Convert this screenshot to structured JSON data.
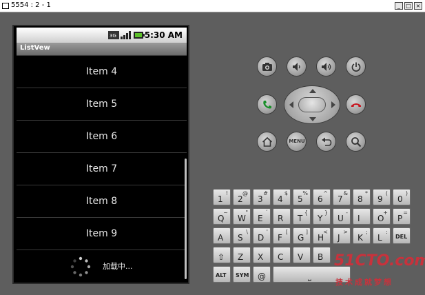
{
  "window": {
    "title": "5554 : 2 - 1",
    "minimize": "_",
    "maximize": "□",
    "close": "×"
  },
  "status_bar": {
    "time": "5:30 AM"
  },
  "app": {
    "title": "ListVew"
  },
  "list": {
    "items": [
      "Item 4",
      "Item 5",
      "Item 6",
      "Item 7",
      "Item 8",
      "Item 9"
    ],
    "loading_text": "加载中..."
  },
  "controls": {
    "camera": "camera-icon",
    "volume_down": "volume-down-icon",
    "volume_up": "volume-up-icon",
    "power": "power-icon",
    "call": "call-icon",
    "end_call": "end-call-icon",
    "home": "home-icon",
    "menu_label": "MENU",
    "back": "back-icon",
    "search": "search-icon"
  },
  "keyboard": {
    "row1": [
      [
        "1",
        "!"
      ],
      [
        "2",
        "@"
      ],
      [
        "3",
        "#"
      ],
      [
        "4",
        "$"
      ],
      [
        "5",
        "%"
      ],
      [
        "6",
        "^"
      ],
      [
        "7",
        "&"
      ],
      [
        "8",
        "*"
      ],
      [
        "9",
        "("
      ],
      [
        "0",
        ")"
      ]
    ],
    "row2": [
      [
        "Q",
        "~"
      ],
      [
        "W",
        "\""
      ],
      [
        "E",
        "´"
      ],
      [
        "R",
        ""
      ],
      [
        "T",
        "{"
      ],
      [
        "Y",
        "}"
      ],
      [
        "U",
        "-"
      ],
      [
        "I",
        ""
      ],
      [
        "O",
        "+"
      ],
      [
        "P",
        "="
      ]
    ],
    "row3": [
      [
        "A",
        ""
      ],
      [
        "S",
        "\\"
      ],
      [
        "D",
        "'"
      ],
      [
        "F",
        "["
      ],
      [
        "G",
        "]"
      ],
      [
        "H",
        "<"
      ],
      [
        "J",
        ">"
      ],
      [
        "K",
        ";"
      ],
      [
        "L",
        ":"
      ],
      [
        "DEL",
        ""
      ]
    ],
    "row4": [
      [
        "⇧",
        ""
      ],
      [
        "Z",
        ""
      ],
      [
        "X",
        ""
      ],
      [
        "C",
        ""
      ],
      [
        "V",
        ""
      ],
      [
        "B",
        ""
      ]
    ],
    "row5": [
      [
        "ALT",
        ""
      ],
      [
        "SYM",
        ""
      ],
      [
        "@",
        ""
      ],
      [
        "⎵",
        ""
      ]
    ]
  },
  "watermark": {
    "logo": "51CTO.com",
    "subtitle": "技术成就梦想"
  },
  "colors": {
    "call_green": "#1a8f2a",
    "end_red": "#c8141e",
    "watermark_red": "#c8323c"
  }
}
